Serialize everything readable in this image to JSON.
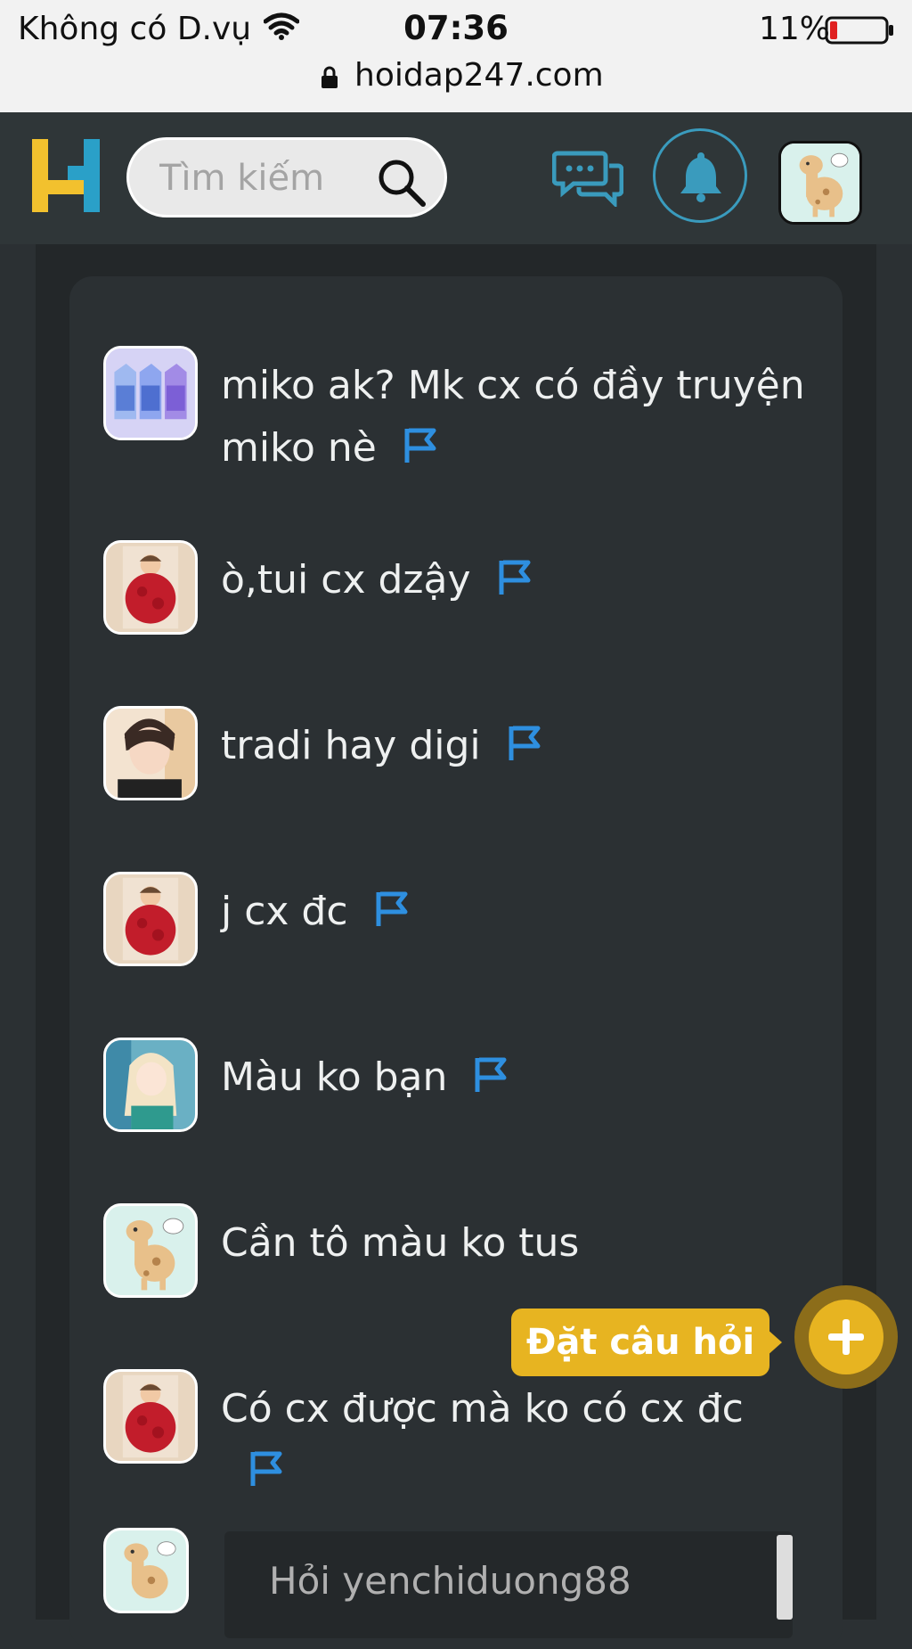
{
  "status_bar": {
    "carrier": "Không có D.vụ",
    "time": "07:36",
    "battery": "11%",
    "url": "hoidap247.com"
  },
  "header": {
    "search_placeholder": "Tìm kiếm",
    "logo_letter": "H"
  },
  "comments": [
    {
      "text": "miko ak? Mk cx có đầy truyện miko nè",
      "avatar": "milk-cartons-avatar",
      "flag": true
    },
    {
      "text": "ò,tui cx dzậy",
      "avatar": "boy-roses-avatar",
      "flag": true
    },
    {
      "text": "tradi hay digi",
      "avatar": "anime-boy-avatar",
      "flag": true
    },
    {
      "text": "j cx đc",
      "avatar": "boy-roses-avatar",
      "flag": true
    },
    {
      "text": "Màu ko bạn",
      "avatar": "anime-girl-avatar",
      "flag": true
    },
    {
      "text": "Cần tô màu ko tus",
      "avatar": "giraffe-avatar",
      "flag": false
    },
    {
      "text": "Có cx được mà ko có cx đc",
      "avatar": "boy-roses-avatar",
      "flag": true
    }
  ],
  "ask_input": {
    "placeholder": "Hỏi yenchiduong88"
  },
  "fab": {
    "label": "Đặt câu hỏi"
  },
  "colors": {
    "background": "#2b3033",
    "accent_yellow": "#e7b421",
    "accent_blue": "#3a9bbd",
    "flag_blue": "#2e8fe0"
  }
}
